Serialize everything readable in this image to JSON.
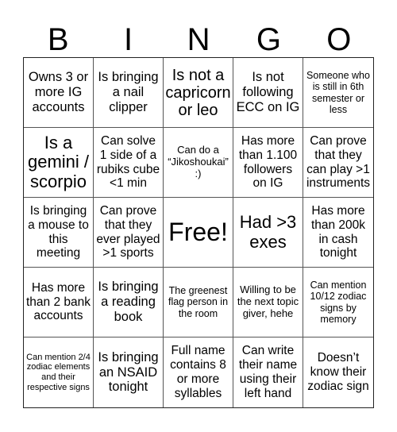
{
  "header": {
    "letters": [
      "B",
      "I",
      "N",
      "G",
      "O"
    ]
  },
  "cells": [
    "Owns 3 or more IG accounts",
    "Is bringing a nail clipper",
    "Is not a capricorn or leo",
    "Is not following ECC on IG",
    "Someone who is still in 6th semester or less",
    "Is a gemini / scorpio",
    "Can solve 1 side of a rubiks cube <1 min",
    "Can do a “Jikoshoukai” :)",
    "Has more than 1.100 followers on IG",
    "Can prove that they can play >1 instruments",
    "Is bringing a mouse to this meeting",
    "Can prove that they ever played >1 sports",
    "Free!",
    "Had >3 exes",
    "Has more than 200k in cash tonight",
    "Has more than 2 bank accounts",
    "Is bringing a reading book",
    "The greenest flag person in the room",
    "Willing to be the next topic giver, hehe",
    "Can mention 10/12 zodiac signs by memory",
    "Can mention 2/4 zodiac elements and their respective signs",
    "Is bringing an NSAID tonight",
    "Full name contains 8 or more syllables",
    "Can write their name using their left hand",
    "Doesn’t know their zodiac sign"
  ]
}
